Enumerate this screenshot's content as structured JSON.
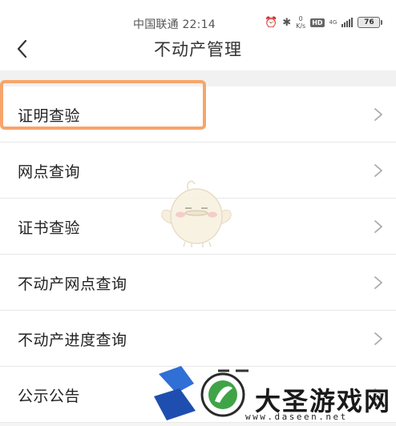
{
  "status_bar": {
    "carrier_time": "中国联通 22:14",
    "speed_value": "0",
    "speed_unit": "K/s",
    "hd_badge": "HD",
    "network_type": "4G",
    "battery": "76",
    "icons": [
      "alarm-icon",
      "bluetooth-icon",
      "signal-icon",
      "battery-icon"
    ]
  },
  "header": {
    "back_icon": "chevron-left-icon",
    "title": "不动产管理"
  },
  "menu": {
    "items": [
      {
        "label": "证明查验",
        "highlighted": true
      },
      {
        "label": "网点查询"
      },
      {
        "label": "证书查验"
      },
      {
        "label": "不动产网点查询"
      },
      {
        "label": "不动产进度查询"
      },
      {
        "label": "公示公告"
      }
    ]
  },
  "highlight_color": "#f7a56a",
  "watermark": {
    "name": "大圣游戏网",
    "url": "www.daseen.net"
  }
}
